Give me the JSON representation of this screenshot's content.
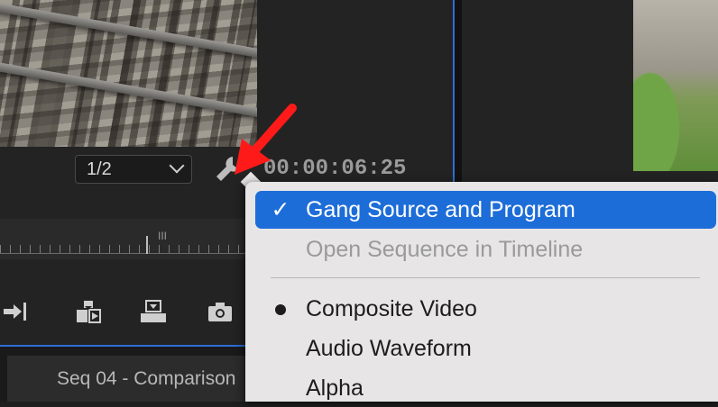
{
  "source_monitor": {
    "resolution": "1/2",
    "timecode": "00:00:06:25",
    "ruler_marker": "III"
  },
  "sequence_tab": {
    "label": "Seq 04 - Comparison"
  },
  "context_menu": {
    "items": [
      {
        "label": "Gang Source and Program",
        "mark": "✓",
        "state": "highlighted"
      },
      {
        "label": "Open Sequence in Timeline",
        "mark": "",
        "state": "disabled"
      },
      {
        "label": "Composite Video",
        "mark": "bullet",
        "state": "selected"
      },
      {
        "label": "Audio Waveform",
        "mark": "",
        "state": "normal"
      },
      {
        "label": "Alpha",
        "mark": "",
        "state": "normal"
      }
    ]
  },
  "icons": {
    "wrench": "wrench-icon",
    "annotation": "red-arrow-icon",
    "overwrite": "overwrite-icon",
    "insert": "insert-icon",
    "lift": "lift-icon",
    "camera": "camera-icon"
  },
  "colors": {
    "accent": "#1d6dd9",
    "panel_border": "#2d6fd6",
    "annotation": "#ff1a1a",
    "menu_bg": "#e7e5e6"
  }
}
